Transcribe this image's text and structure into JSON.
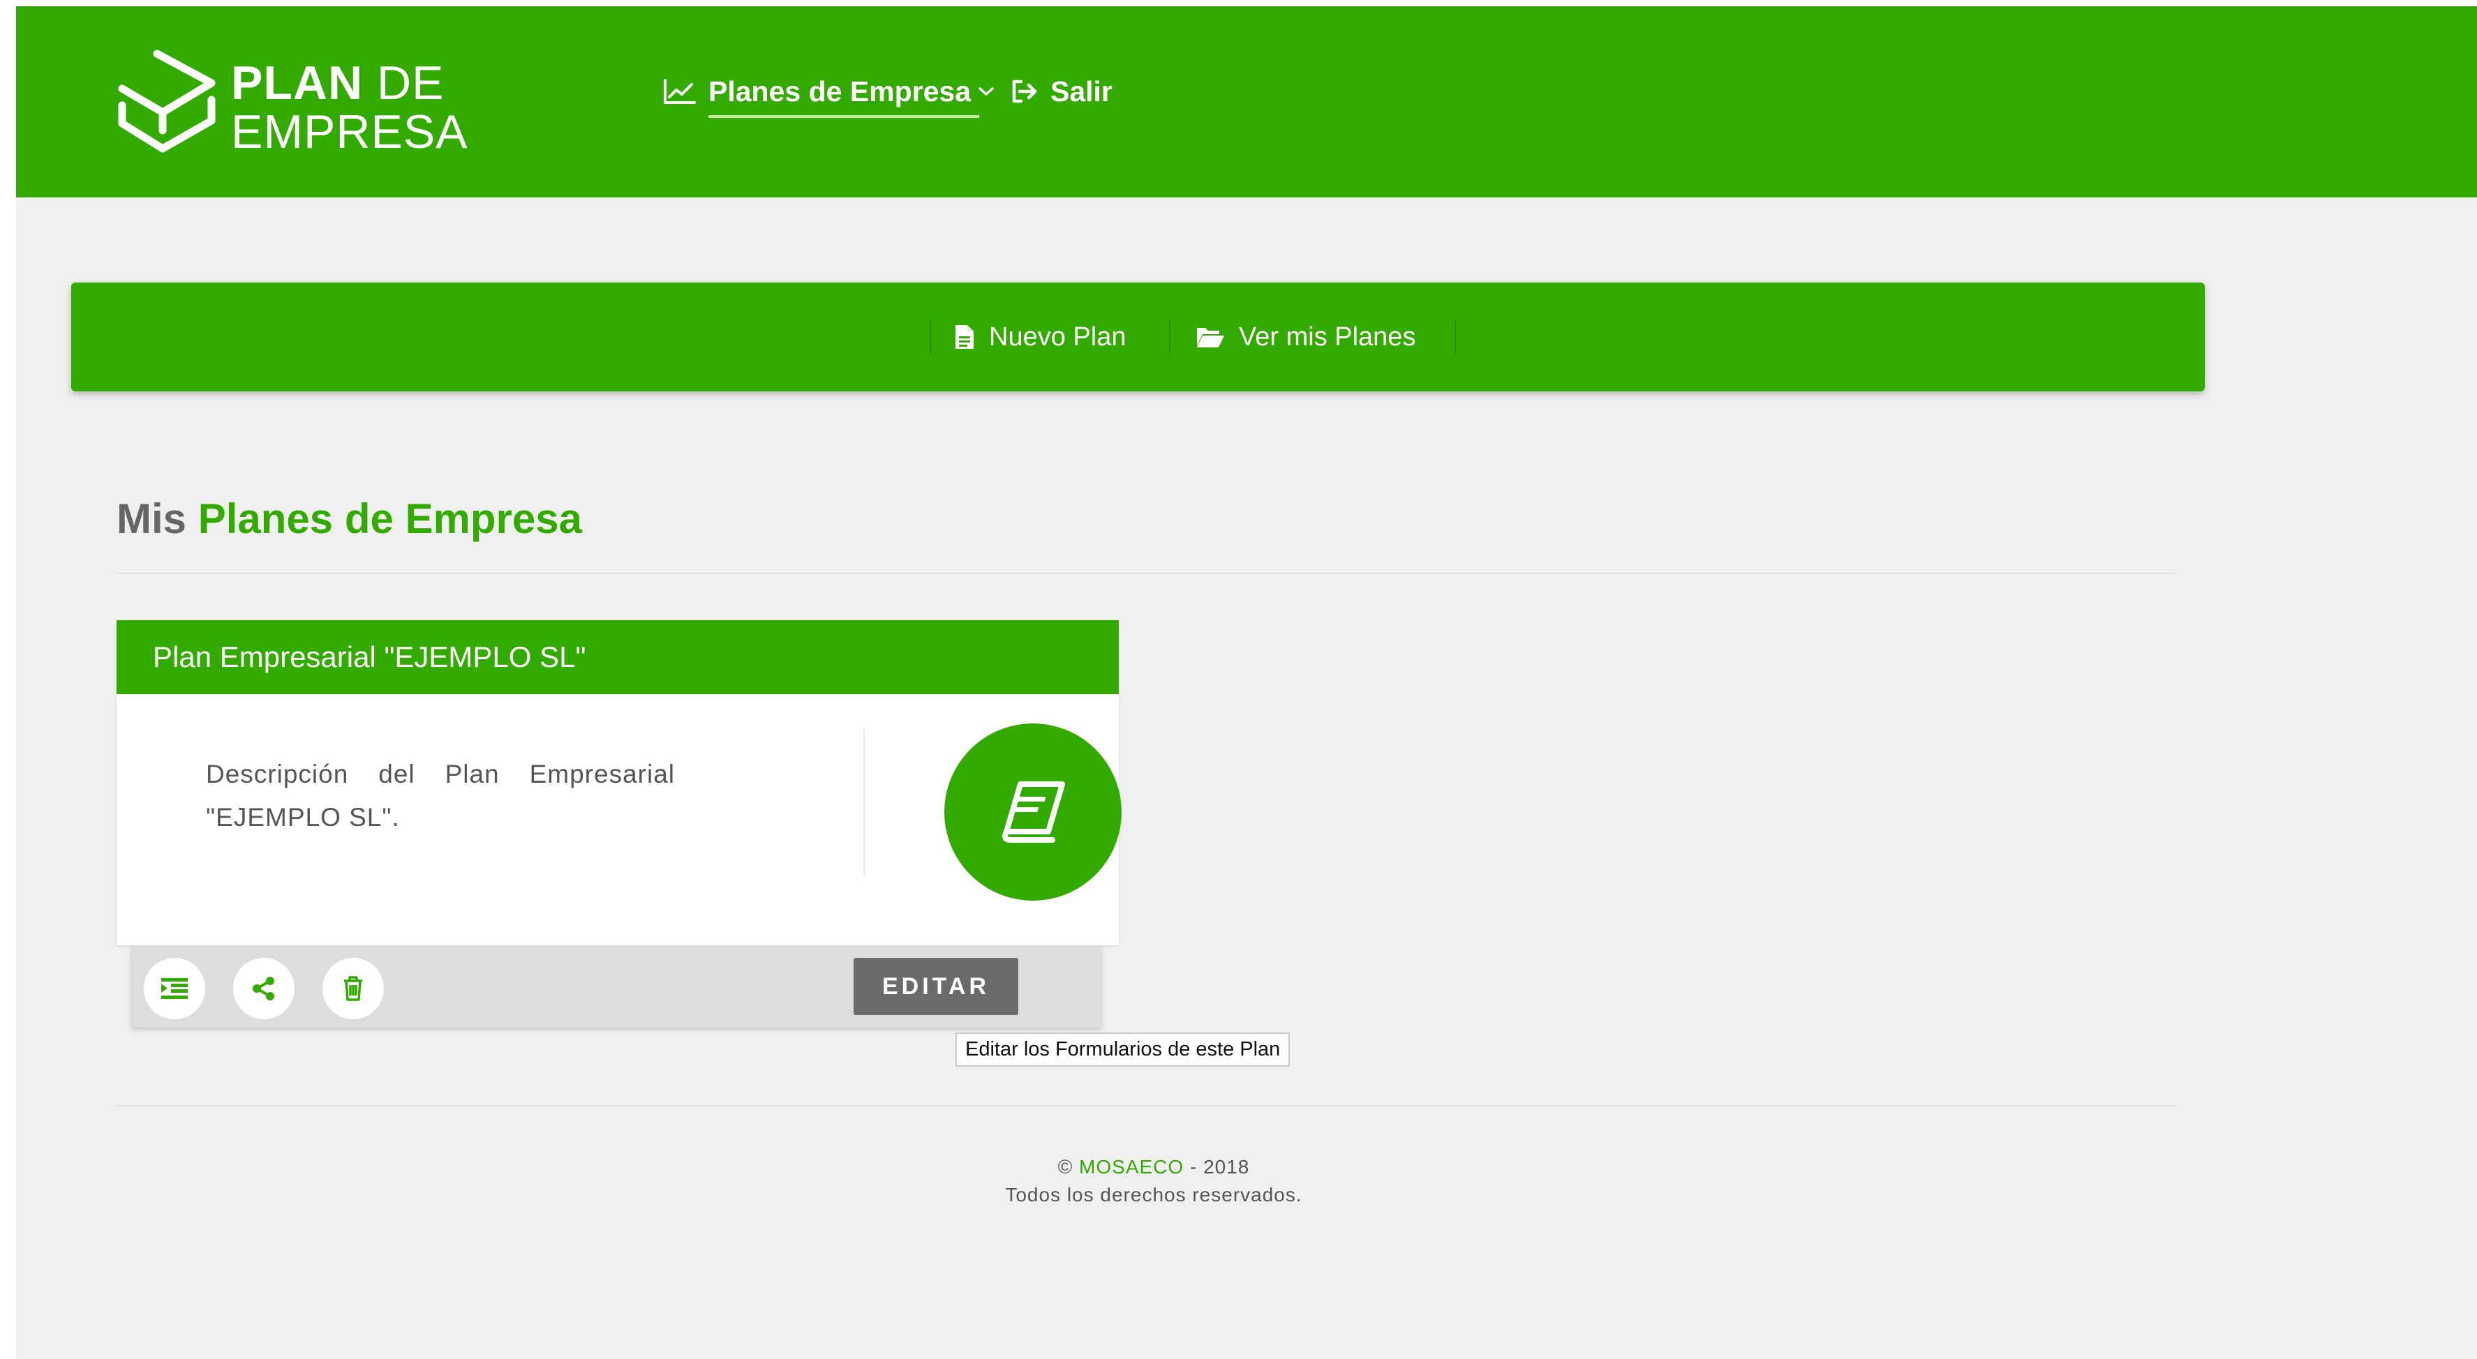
{
  "brand": {
    "line1_bold": "PLAN",
    "line1_light": "DE",
    "line2": "EMPRESA"
  },
  "nav": {
    "plans_label": "Planes de Empresa",
    "exit_label": "Salir"
  },
  "toolbar": {
    "new_plan_label": "Nuevo Plan",
    "view_plans_label": "Ver mis Planes"
  },
  "page": {
    "title_prefix": "Mis",
    "title_accent": "Planes de Empresa"
  },
  "card": {
    "title": "Plan Empresarial \"EJEMPLO SL\"",
    "description": "Descripción del Plan Empresarial \"EJEMPLO SL\".",
    "edit_label": "EDITAR",
    "edit_tooltip": "Editar los Formularios de este Plan",
    "emblem_icon": "book-icon",
    "action_icons": [
      "list-icon",
      "share-icon",
      "trash-icon"
    ]
  },
  "footer": {
    "copyright_symbol": "©",
    "company": "MOSAECO",
    "year_text": "- 2018",
    "rights": "Todos los derechos reservados."
  },
  "colors": {
    "primary_green": "#33aa00",
    "background": "#f0f0f0",
    "edit_button": "#6b6b6b"
  }
}
